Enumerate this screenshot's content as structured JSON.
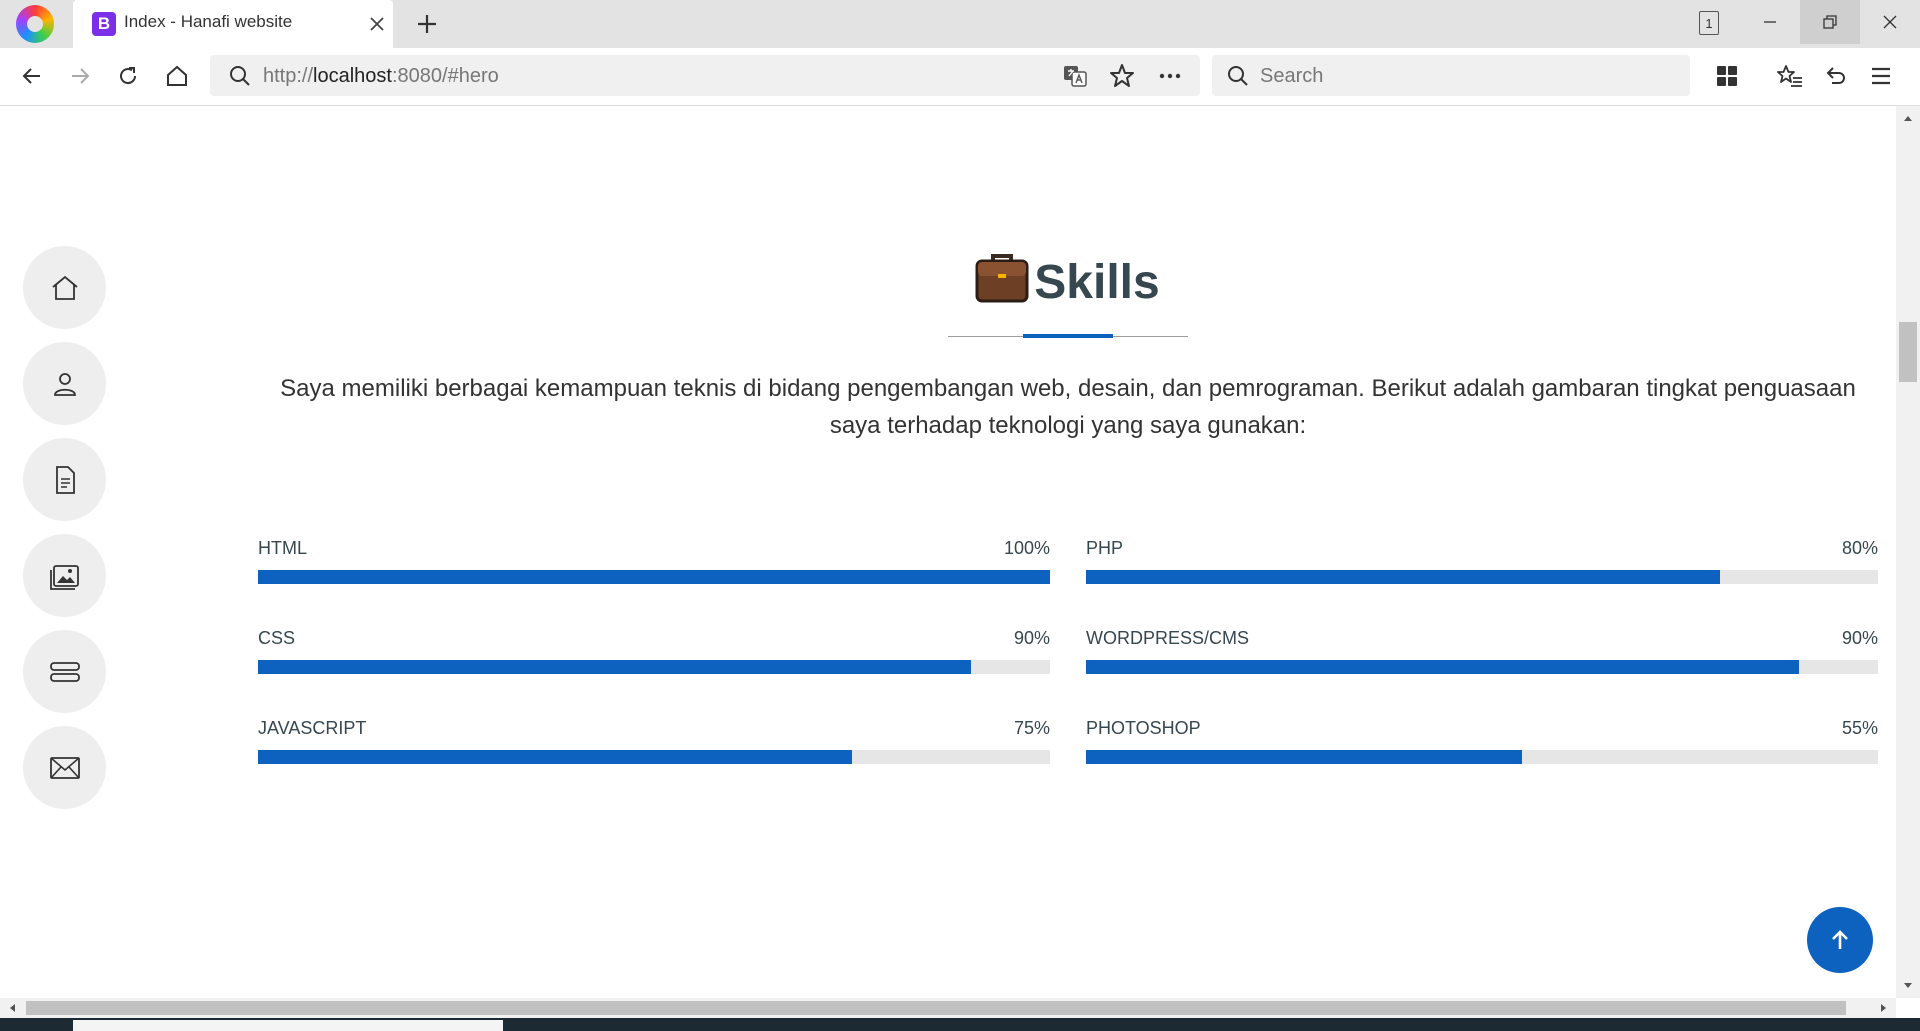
{
  "browser": {
    "tab_title": "Index - Hanafi website",
    "tab_favicon_letter": "B",
    "tab_count": "1",
    "url_prefix": "http://",
    "url_host": "localhost",
    "url_rest": ":8080/#hero",
    "search_placeholder": "Search"
  },
  "sidebar": {
    "items": [
      {
        "icon": "home-icon"
      },
      {
        "icon": "person-icon"
      },
      {
        "icon": "document-icon"
      },
      {
        "icon": "image-icon"
      },
      {
        "icon": "server-icon"
      },
      {
        "icon": "envelope-icon"
      }
    ]
  },
  "skills_section": {
    "title": "Skills",
    "intro": "Saya memiliki berbagai kemampuan teknis di bidang pengembangan web, desain, dan pemrograman. Berikut adalah gambaran tingkat penguasaan saya terhadap teknologi yang saya gunakan:",
    "skills": [
      {
        "name": "HTML",
        "value_label": "100%",
        "percent": 100
      },
      {
        "name": "CSS",
        "value_label": "90%",
        "percent": 90
      },
      {
        "name": "JAVASCRIPT",
        "value_label": "75%",
        "percent": 75
      },
      {
        "name": "PHP",
        "value_label": "80%",
        "percent": 80
      },
      {
        "name": "WORDPRESS/CMS",
        "value_label": "90%",
        "percent": 90
      },
      {
        "name": "PHOTOSHOP",
        "value_label": "55%",
        "percent": 55
      }
    ]
  },
  "colors": {
    "accent": "#0d62c0",
    "track": "#e6e6e6",
    "heading": "#37474f"
  }
}
